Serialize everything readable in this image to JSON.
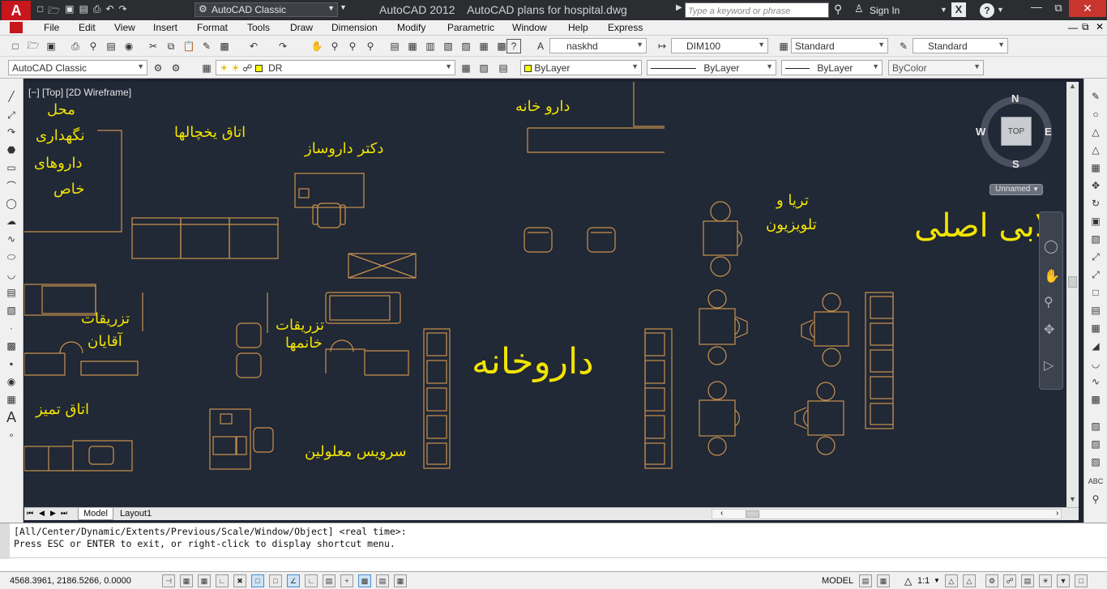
{
  "title_bar": {
    "app_logo": "A",
    "workspace": "AutoCAD Classic",
    "window_title": "AutoCAD 2012    AutoCAD plans for hospital.dwg",
    "search_placeholder": "Type a keyword or phrase",
    "sign_in": "Sign In",
    "help": "?"
  },
  "menu": [
    "File",
    "Edit",
    "View",
    "Insert",
    "Format",
    "Tools",
    "Draw",
    "Dimension",
    "Modify",
    "Parametric",
    "Window",
    "Help",
    "Express"
  ],
  "styles_toolbar": {
    "text_style": "naskhd",
    "dim_style": "DIM100",
    "table_style": "Standard",
    "multileader_style": "Standard"
  },
  "layers_toolbar": {
    "workspace": "AutoCAD Classic",
    "layer": "DR",
    "color": "ByLayer",
    "linetype": "ByLayer",
    "lineweight": "ByLayer",
    "plot_style": "ByColor"
  },
  "viewport": {
    "view_label": "[−] [Top] [2D Wireframe]",
    "viewcube": {
      "top": "TOP",
      "n": "N",
      "s": "S",
      "e": "E",
      "w": "W",
      "ucs": "Unnamed"
    },
    "labels": {
      "special_storage_1": "محل",
      "special_storage_2": "نگهداری",
      "special_storage_3": "داروهای",
      "special_storage_4": "خاص",
      "fridge_room": "اتاق یخچالها",
      "pharmacist": "دکتر داروساز",
      "pharmacy_top": "دارو خانه",
      "cafe_1": "تریا و",
      "cafe_2": "تلویزیون",
      "main_lobby": "لابی اصلی",
      "men_inject_1": "تزریقات",
      "men_inject_2": "آقایان",
      "women_inject_1": "تزریقات",
      "women_inject_2": "خانمها",
      "pharmacy_big": "داروخانه",
      "clean_room": "اتاق تمیز",
      "disabled_wc": "سرویس معلولین"
    },
    "colors": {
      "text": "#f2e400",
      "lines": "#c8924e",
      "background": "#212836"
    }
  },
  "tabs": [
    "Model",
    "Layout1"
  ],
  "command_line": {
    "line1": "[All/Center/Dynamic/Extents/Previous/Scale/Window/Object] <real time>:",
    "line2": "Press ESC or ENTER to exit, or right-click to display shortcut menu."
  },
  "status_bar": {
    "coordinates": "4568.3961, 2186.5266, 0.0000",
    "model": "MODEL",
    "annotation_scale": "1:1"
  }
}
